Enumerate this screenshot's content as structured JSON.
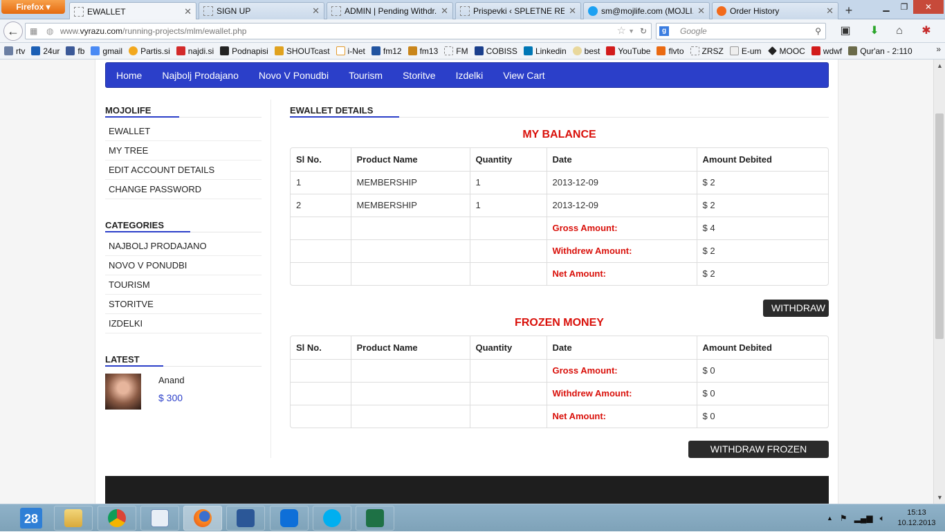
{
  "browser": {
    "menu_label": "Firefox ▾",
    "tabs": [
      {
        "title": "EWALLET",
        "active": true
      },
      {
        "title": "SIGN UP"
      },
      {
        "title": "ADMIN | Pending Withdr..."
      },
      {
        "title": "Prispevki ‹ SPLETNE REŠI..."
      },
      {
        "title": "sm@mojlife.com (MOJLI..."
      },
      {
        "title": "Order History"
      }
    ],
    "url_prefix": "www.",
    "url_domain": "vyrazu.com",
    "url_path": "/running-projects/mlm/ewallet.php",
    "search_placeholder": "Google",
    "bookmarks": [
      "rtv",
      "24ur",
      "fb",
      "gmail",
      "Partis.si",
      "najdi.si",
      "Podnapisi",
      "SHOUTcast",
      "i-Net",
      "fm12",
      "fm13",
      "FM",
      "COBISS",
      "Linkedin",
      "best",
      "YouTube",
      "flvto",
      "ZRSZ",
      "E-um",
      "MOOC",
      "wdwf",
      "Qur'an - 2:110"
    ]
  },
  "site": {
    "menu": [
      "Home",
      "Najbolj Prodajano",
      "Novo V Ponudbi",
      "Tourism",
      "Storitve",
      "Izdelki",
      "View Cart"
    ],
    "sidebar": {
      "mojolife_heading": "MOJOLIFE",
      "mojolife_items": [
        "EWALLET",
        "MY TREE",
        "EDIT ACCOUNT DETAILS",
        "CHANGE PASSWORD"
      ],
      "categories_heading": "CATEGORIES",
      "categories_items": [
        "NAJBOLJ PRODAJANO",
        "NOVO V PONUDBI",
        "TOURISM",
        "STORITVE",
        "IZDELKI"
      ],
      "latest_heading": "LATEST",
      "latest_item": {
        "name": "Anand",
        "price": "$ 300"
      }
    },
    "main": {
      "heading": "EWALLET DETAILS",
      "balance_title": "MY BALANCE",
      "columns": [
        "Sl No.",
        "Product Name",
        "Quantity",
        "Date",
        "Amount Debited"
      ],
      "balance_rows": [
        [
          "1",
          "MEMBERSHIP",
          "1",
          "2013-12-09",
          "$ 2"
        ],
        [
          "2",
          "MEMBERSHIP",
          "1",
          "2013-12-09",
          "$ 2"
        ]
      ],
      "balance_summary": [
        {
          "label": "Gross Amount:",
          "value": "$ 4"
        },
        {
          "label": "Withdrew Amount:",
          "value": "$ 2"
        },
        {
          "label": "Net Amount:",
          "value": "$ 2"
        }
      ],
      "withdraw_button": "WITHDRAW",
      "frozen_title": "FROZEN MONEY",
      "frozen_summary": [
        {
          "label": "Gross Amount:",
          "value": "$ 0"
        },
        {
          "label": "Withdrew Amount:",
          "value": "$ 0"
        },
        {
          "label": "Net Amount:",
          "value": "$ 0"
        }
      ],
      "withdraw_frozen_button": "WITHDRAW FROZEN MONEY"
    }
  },
  "taskbar": {
    "calendar_day": "28",
    "time": "15:13",
    "date": "10.12.2013"
  },
  "colors": {
    "menu_blue": "#2b3fc9",
    "accent_red": "#d9100a"
  }
}
